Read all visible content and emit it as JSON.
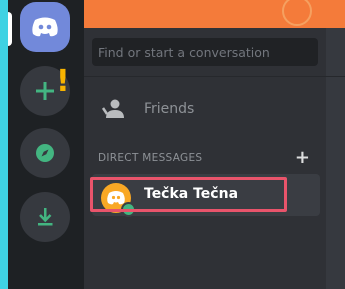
{
  "servers": {
    "home_icon": "discord-logo-icon",
    "add_icon": "plus-icon",
    "explore_icon": "compass-icon",
    "download_icon": "download-icon",
    "alert": "!"
  },
  "search": {
    "placeholder": "Find or start a conversation"
  },
  "nav": {
    "friends_label": "Friends",
    "friends_icon": "friends-icon"
  },
  "direct_messages": {
    "header": "DIRECT MESSAGES",
    "add_symbol": "+",
    "items": [
      {
        "name": "Tečka Tečna",
        "status": "online"
      }
    ]
  },
  "colors": {
    "accent": "#7289da",
    "banner": "#f47b3a",
    "highlight": "#e9546b",
    "online": "#43b581",
    "alert": "#f8b400"
  }
}
